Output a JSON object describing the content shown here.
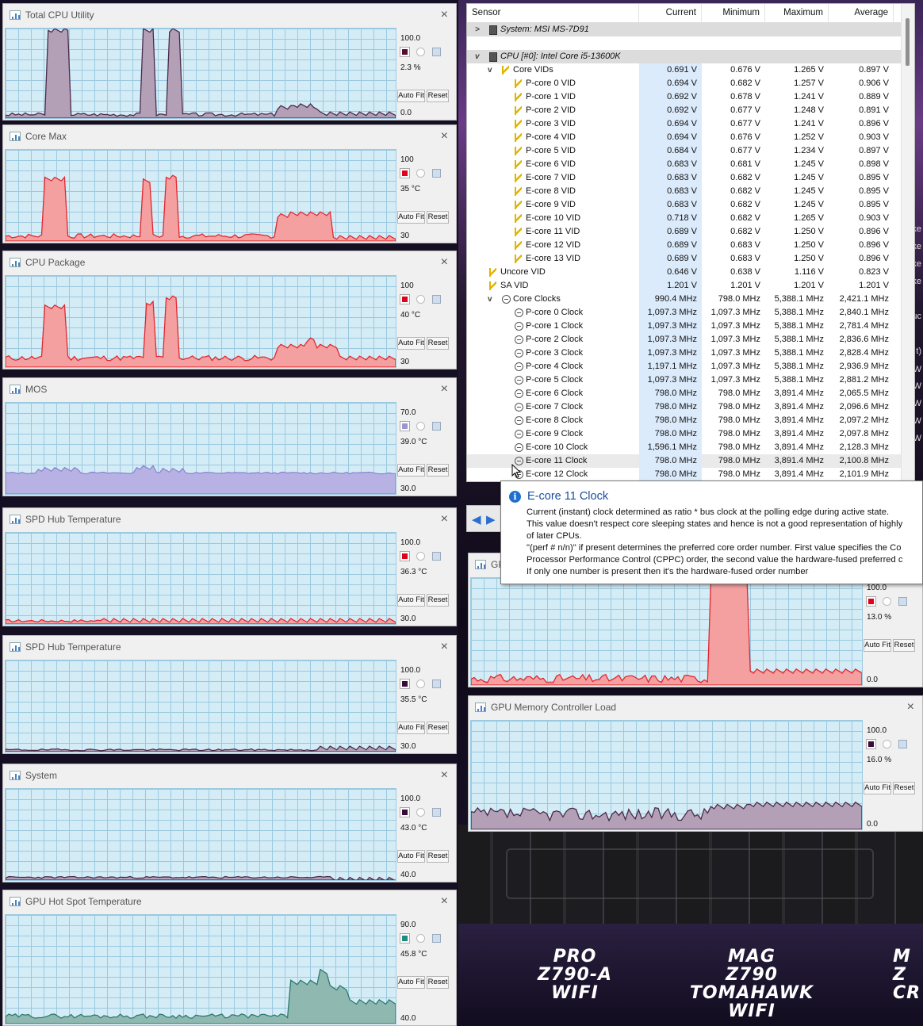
{
  "graphs_left": [
    {
      "title": "Total CPU Utility",
      "max": "100.0",
      "current": "2.3 %",
      "min": "0.0",
      "swatch": "#5a0a32",
      "fill": "#b3a0b6",
      "stroke": "#4a2a4c"
    },
    {
      "title": "Core Max",
      "max": "100",
      "current": "35 °C",
      "min": "30",
      "swatch": "#e0001a",
      "fill": "#f5a0a0",
      "stroke": "#e3262e"
    },
    {
      "title": "CPU Package",
      "max": "100",
      "current": "40 °C",
      "min": "30",
      "swatch": "#e0001a",
      "fill": "#f5a0a0",
      "stroke": "#e3262e"
    },
    {
      "title": "MOS",
      "max": "70.0",
      "current": "39.0 °C",
      "min": "30.0",
      "swatch": "#9a95d6",
      "fill": "#b8b2e4",
      "stroke": "#8b84d2"
    },
    {
      "title": "SPD Hub Temperature",
      "max": "100.0",
      "current": "36.3 °C",
      "min": "30.0",
      "swatch": "#e0001a",
      "fill": "#f5a0a0",
      "stroke": "#e3262e"
    },
    {
      "title": "SPD Hub Temperature",
      "max": "100.0",
      "current": "35.5 °C",
      "min": "30.0",
      "swatch": "#3a0a3a",
      "fill": "#b3a0b6",
      "stroke": "#4a2a4c"
    },
    {
      "title": "System",
      "max": "100.0",
      "current": "43.0 °C",
      "min": "40.0",
      "swatch": "#3a0a3a",
      "fill": "#b3a0b6",
      "stroke": "#4a2a4c"
    },
    {
      "title": "GPU Hot Spot Temperature",
      "max": "90.0",
      "current": "45.8 °C",
      "min": "40.0",
      "swatch": "#1e8c80",
      "fill": "#8fb8b0",
      "stroke": "#2a7a70"
    }
  ],
  "graphs_right": [
    {
      "title": "GPU Load",
      "max": "100.0",
      "current": "13.0 %",
      "min": "0.0",
      "swatch": "#e0001a",
      "fill": "#f5a0a0",
      "stroke": "#e3262e"
    },
    {
      "title": "GPU Memory Controller Load",
      "max": "100.0",
      "current": "16.0 %",
      "min": "0.0",
      "swatch": "#3a0a3a",
      "fill": "#b3a0b6",
      "stroke": "#4a2a4c"
    }
  ],
  "buttons": {
    "auto_fit": "Auto Fit",
    "reset": "Reset",
    "close": "×"
  },
  "table": {
    "headers": [
      "Sensor",
      "Current",
      "Minimum",
      "Maximum",
      "Average"
    ],
    "rows": [
      {
        "type": "grp",
        "indent": 0,
        "toggle": ">",
        "icon": "chip",
        "name": "System: MSI MS-7D91",
        "v": [
          "",
          "",
          "",
          ""
        ]
      },
      {
        "type": "blank",
        "indent": 0,
        "toggle": "",
        "icon": "",
        "name": "",
        "v": [
          "",
          "",
          "",
          ""
        ]
      },
      {
        "type": "grp",
        "indent": 0,
        "toggle": "v",
        "icon": "chip",
        "name": "CPU [#0]: Intel Core i5-13600K",
        "v": [
          "",
          "",
          "",
          ""
        ]
      },
      {
        "type": "",
        "indent": 1,
        "toggle": "v",
        "icon": "volt",
        "name": "Core VIDs",
        "v": [
          "0.691 V",
          "0.676 V",
          "1.265 V",
          "0.897 V"
        ]
      },
      {
        "type": "",
        "indent": 2,
        "toggle": "",
        "icon": "volt",
        "name": "P-core 0 VID",
        "v": [
          "0.694 V",
          "0.682 V",
          "1.257 V",
          "0.906 V"
        ]
      },
      {
        "type": "",
        "indent": 2,
        "toggle": "",
        "icon": "volt",
        "name": "P-core 1 VID",
        "v": [
          "0.692 V",
          "0.678 V",
          "1.241 V",
          "0.889 V"
        ]
      },
      {
        "type": "",
        "indent": 2,
        "toggle": "",
        "icon": "volt",
        "name": "P-core 2 VID",
        "v": [
          "0.692 V",
          "0.677 V",
          "1.248 V",
          "0.891 V"
        ]
      },
      {
        "type": "",
        "indent": 2,
        "toggle": "",
        "icon": "volt",
        "name": "P-core 3 VID",
        "v": [
          "0.694 V",
          "0.677 V",
          "1.241 V",
          "0.896 V"
        ]
      },
      {
        "type": "",
        "indent": 2,
        "toggle": "",
        "icon": "volt",
        "name": "P-core 4 VID",
        "v": [
          "0.694 V",
          "0.676 V",
          "1.252 V",
          "0.903 V"
        ]
      },
      {
        "type": "",
        "indent": 2,
        "toggle": "",
        "icon": "volt",
        "name": "P-core 5 VID",
        "v": [
          "0.684 V",
          "0.677 V",
          "1.234 V",
          "0.897 V"
        ]
      },
      {
        "type": "",
        "indent": 2,
        "toggle": "",
        "icon": "volt",
        "name": "E-core 6 VID",
        "v": [
          "0.683 V",
          "0.681 V",
          "1.245 V",
          "0.898 V"
        ]
      },
      {
        "type": "",
        "indent": 2,
        "toggle": "",
        "icon": "volt",
        "name": "E-core 7 VID",
        "v": [
          "0.683 V",
          "0.682 V",
          "1.245 V",
          "0.895 V"
        ]
      },
      {
        "type": "",
        "indent": 2,
        "toggle": "",
        "icon": "volt",
        "name": "E-core 8 VID",
        "v": [
          "0.683 V",
          "0.682 V",
          "1.245 V",
          "0.895 V"
        ]
      },
      {
        "type": "",
        "indent": 2,
        "toggle": "",
        "icon": "volt",
        "name": "E-core 9 VID",
        "v": [
          "0.683 V",
          "0.682 V",
          "1.245 V",
          "0.895 V"
        ]
      },
      {
        "type": "",
        "indent": 2,
        "toggle": "",
        "icon": "volt",
        "name": "E-core 10 VID",
        "v": [
          "0.718 V",
          "0.682 V",
          "1.265 V",
          "0.903 V"
        ]
      },
      {
        "type": "",
        "indent": 2,
        "toggle": "",
        "icon": "volt",
        "name": "E-core 11 VID",
        "v": [
          "0.689 V",
          "0.682 V",
          "1.250 V",
          "0.896 V"
        ]
      },
      {
        "type": "",
        "indent": 2,
        "toggle": "",
        "icon": "volt",
        "name": "E-core 12 VID",
        "v": [
          "0.689 V",
          "0.683 V",
          "1.250 V",
          "0.896 V"
        ]
      },
      {
        "type": "",
        "indent": 2,
        "toggle": "",
        "icon": "volt",
        "name": "E-core 13 VID",
        "v": [
          "0.689 V",
          "0.683 V",
          "1.250 V",
          "0.896 V"
        ]
      },
      {
        "type": "",
        "indent": 0,
        "toggle": "",
        "icon": "volt",
        "name": "Uncore VID",
        "v": [
          "0.646 V",
          "0.638 V",
          "1.116 V",
          "0.823 V"
        ]
      },
      {
        "type": "",
        "indent": 0,
        "toggle": "",
        "icon": "volt",
        "name": "SA VID",
        "v": [
          "1.201 V",
          "1.201 V",
          "1.201 V",
          "1.201 V"
        ]
      },
      {
        "type": "",
        "indent": 1,
        "toggle": "v",
        "icon": "clk",
        "name": "Core Clocks",
        "v": [
          "990.4 MHz",
          "798.0 MHz",
          "5,388.1 MHz",
          "2,421.1 MHz"
        ]
      },
      {
        "type": "",
        "indent": 2,
        "toggle": "",
        "icon": "clk",
        "name": "P-core 0 Clock",
        "v": [
          "1,097.3 MHz",
          "1,097.3 MHz",
          "5,388.1 MHz",
          "2,840.1 MHz"
        ]
      },
      {
        "type": "",
        "indent": 2,
        "toggle": "",
        "icon": "clk",
        "name": "P-core 1 Clock",
        "v": [
          "1,097.3 MHz",
          "1,097.3 MHz",
          "5,388.1 MHz",
          "2,781.4 MHz"
        ]
      },
      {
        "type": "",
        "indent": 2,
        "toggle": "",
        "icon": "clk",
        "name": "P-core 2 Clock",
        "v": [
          "1,097.3 MHz",
          "1,097.3 MHz",
          "5,388.1 MHz",
          "2,836.6 MHz"
        ]
      },
      {
        "type": "",
        "indent": 2,
        "toggle": "",
        "icon": "clk",
        "name": "P-core 3 Clock",
        "v": [
          "1,097.3 MHz",
          "1,097.3 MHz",
          "5,388.1 MHz",
          "2,828.4 MHz"
        ]
      },
      {
        "type": "",
        "indent": 2,
        "toggle": "",
        "icon": "clk",
        "name": "P-core 4 Clock",
        "v": [
          "1,197.1 MHz",
          "1,097.3 MHz",
          "5,388.1 MHz",
          "2,936.9 MHz"
        ]
      },
      {
        "type": "",
        "indent": 2,
        "toggle": "",
        "icon": "clk",
        "name": "P-core 5 Clock",
        "v": [
          "1,097.3 MHz",
          "1,097.3 MHz",
          "5,388.1 MHz",
          "2,881.2 MHz"
        ]
      },
      {
        "type": "",
        "indent": 2,
        "toggle": "",
        "icon": "clk",
        "name": "E-core 6 Clock",
        "v": [
          "798.0 MHz",
          "798.0 MHz",
          "3,891.4 MHz",
          "2,065.5 MHz"
        ]
      },
      {
        "type": "",
        "indent": 2,
        "toggle": "",
        "icon": "clk",
        "name": "E-core 7 Clock",
        "v": [
          "798.0 MHz",
          "798.0 MHz",
          "3,891.4 MHz",
          "2,096.6 MHz"
        ]
      },
      {
        "type": "",
        "indent": 2,
        "toggle": "",
        "icon": "clk",
        "name": "E-core 8 Clock",
        "v": [
          "798.0 MHz",
          "798.0 MHz",
          "3,891.4 MHz",
          "2,097.2 MHz"
        ]
      },
      {
        "type": "",
        "indent": 2,
        "toggle": "",
        "icon": "clk",
        "name": "E-core 9 Clock",
        "v": [
          "798.0 MHz",
          "798.0 MHz",
          "3,891.4 MHz",
          "2,097.8 MHz"
        ]
      },
      {
        "type": "",
        "indent": 2,
        "toggle": "",
        "icon": "clk",
        "name": "E-core 10 Clock",
        "v": [
          "1,596.1 MHz",
          "798.0 MHz",
          "3,891.4 MHz",
          "2,128.3 MHz"
        ]
      },
      {
        "type": "sel",
        "indent": 2,
        "toggle": "",
        "icon": "clk",
        "name": "E-core 11 Clock",
        "v": [
          "798.0 MHz",
          "798.0 MHz",
          "3,891.4 MHz",
          "2,100.8 MHz"
        ]
      },
      {
        "type": "",
        "indent": 2,
        "toggle": "",
        "icon": "clk",
        "name": "E-core 12 Clock",
        "v": [
          "798.0 MHz",
          "798.0 MHz",
          "3,891.4 MHz",
          "2,101.9 MHz"
        ]
      }
    ]
  },
  "tooltip": {
    "title": "E-core 11 Clock",
    "lines": [
      "Current (instant) clock determined as ratio * bus clock at the polling edge during active state.",
      "This value doesn't respect core sleeping states and hence is not a good representation of highly",
      "of later CPUs.",
      "\"(perf # n/n)\" if present determines the preferred core order number. First value specifies the Co",
      "Processor Performance Control (CPPC) order, the second value the hardware-fused preferred c",
      "If only one number is present then it's the hardware-fused order number"
    ]
  },
  "nav": {
    "back": "◀",
    "forward": "▶"
  },
  "edge_texts": [
    "ke",
    "ke",
    "ke",
    "ke",
    "uc",
    "t)",
    "W",
    "W",
    "W",
    "W",
    "W"
  ],
  "desktop_brands": [
    {
      "lines": [
        "PRO",
        "Z790-A",
        "WIFI"
      ]
    },
    {
      "lines": [
        "MAG",
        "Z790",
        "TOMAHAWK",
        "WIFI"
      ]
    },
    {
      "lines": [
        "M",
        "Z",
        "CR"
      ]
    }
  ]
}
